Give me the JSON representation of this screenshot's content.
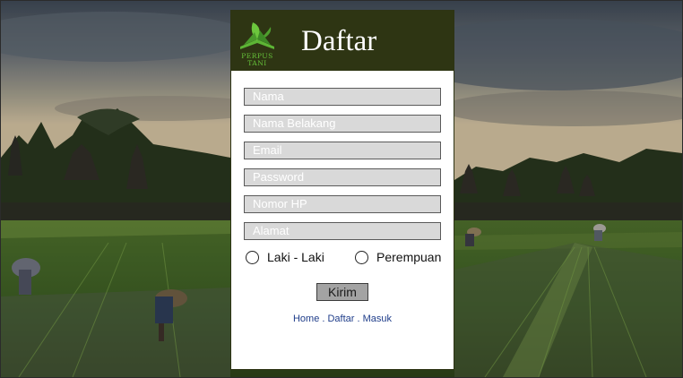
{
  "header": {
    "title": "Daftar",
    "logo_line1": "PERPUS",
    "logo_line2": "TANI"
  },
  "form": {
    "fields": [
      {
        "placeholder": "Nama"
      },
      {
        "placeholder": "Nama Belakang"
      },
      {
        "placeholder": "Email"
      },
      {
        "placeholder": "Password"
      },
      {
        "placeholder": "Nomor HP"
      },
      {
        "placeholder": "Alamat"
      }
    ],
    "gender_options": [
      "Laki - Laki",
      "Perempuan"
    ],
    "submit_label": "Kirim"
  },
  "footer_links": [
    "Home",
    "Daftar",
    "Masuk"
  ],
  "footer_sep": " . ",
  "colors": {
    "header_bg": "#2e3513",
    "logo_green": "#66c23a",
    "link_blue": "#1f3d8a",
    "field_bg": "#d9d9d9",
    "button_bg": "#a3a3a3"
  }
}
